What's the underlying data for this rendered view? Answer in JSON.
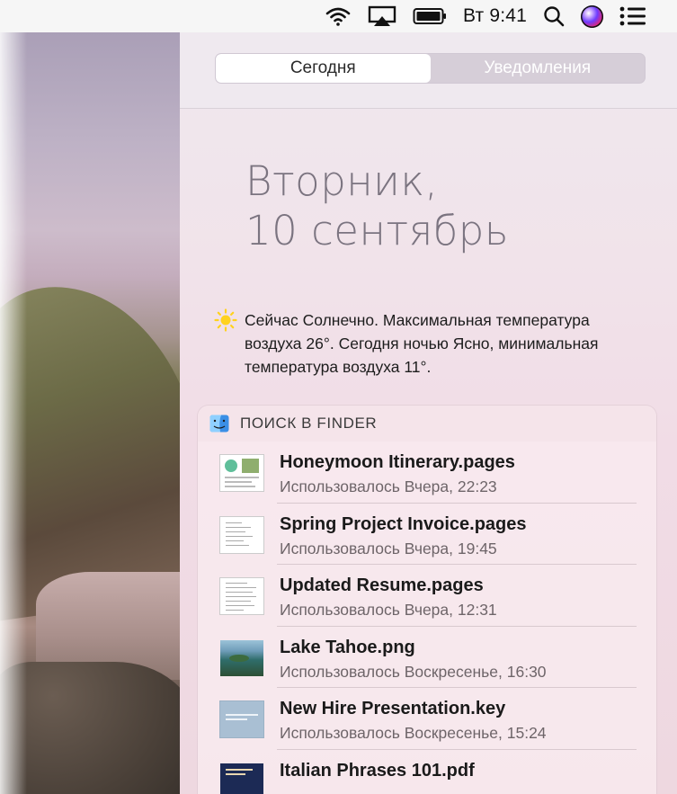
{
  "menubar": {
    "clock": "Вт 9:41",
    "icons": [
      "wifi-icon",
      "airplay-icon",
      "battery-icon",
      "spotlight-search-icon",
      "siri-icon",
      "notification-center-icon"
    ]
  },
  "notification_center": {
    "tabs": [
      {
        "label": "Сегодня",
        "active": true
      },
      {
        "label": "Уведомления",
        "active": false
      }
    ],
    "date": {
      "weekday": "Вторник,",
      "day_month": "10 сентябрь"
    },
    "weather": {
      "icon": "sun-icon",
      "summary": "Сейчас Солнечно. Максимальная температура воздуха 26°. Сегодня ночью Ясно, минимальная температура воздуха 11°."
    },
    "finder_widget": {
      "title": "ПОИСК В FINDER",
      "icon": "finder-icon",
      "files": [
        {
          "name": "Honeymoon Itinerary.pages",
          "meta": "Использовалось Вчера, 22:23",
          "thumb": "pages-document-thumbnail"
        },
        {
          "name": "Spring Project Invoice.pages",
          "meta": "Использовалось Вчера, 19:45",
          "thumb": "pages-document-thumbnail"
        },
        {
          "name": "Updated Resume.pages",
          "meta": "Использовалось Вчера, 12:31",
          "thumb": "pages-document-thumbnail"
        },
        {
          "name": "Lake Tahoe.png",
          "meta": "Использовалось Воскресенье, 16:30",
          "thumb": "image-thumbnail"
        },
        {
          "name": "New Hire Presentation.key",
          "meta": "Использовалось Воскресенье, 15:24",
          "thumb": "keynote-thumbnail"
        },
        {
          "name": "Italian Phrases 101.pdf",
          "meta": "",
          "thumb": "pdf-thumbnail"
        }
      ]
    }
  },
  "colors": {
    "menubar_bg": "#f6f6f6",
    "panel_bg": "#f1e3ea",
    "date_text": "#7b7480",
    "segment_inactive_bg": "#d6ced8"
  }
}
